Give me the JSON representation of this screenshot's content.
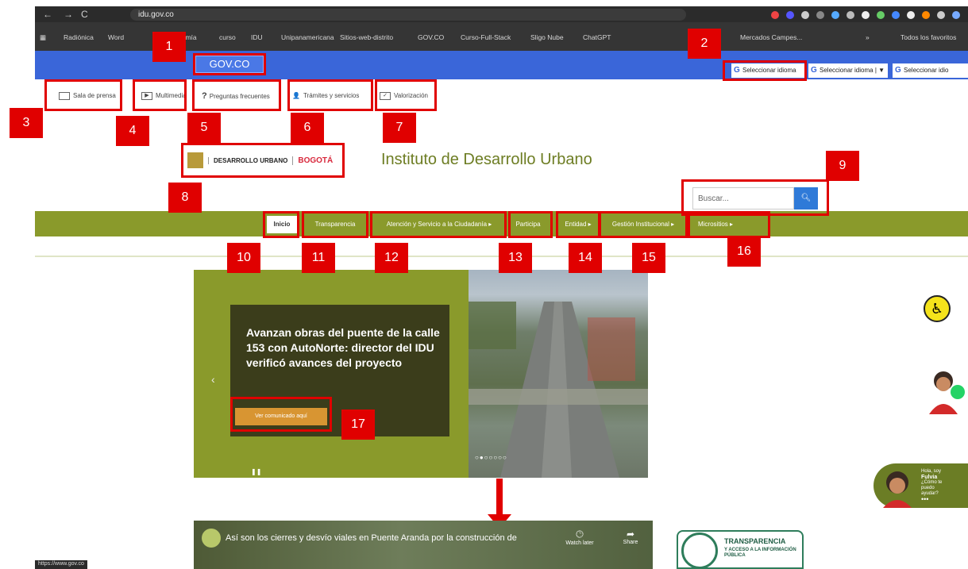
{
  "browser": {
    "url": "idu.gov.co",
    "bookmarks": [
      "Radiónica",
      "Word",
      "nomía",
      "curso",
      "IDU",
      "Unipanamericana",
      "Sitios-web-distrito",
      "GOV.CO",
      "Curso-Full-Stack",
      "Sligo Nube",
      "ChatGPT",
      "Mercados Campes...",
      "»",
      "Todos los favoritos"
    ],
    "status_url": "https://www.gov.co"
  },
  "gov_bar": {
    "logo": "GOV.CO",
    "language_selectors": [
      "Seleccionar idioma",
      "Seleccionar idioma | ▼",
      "Seleccionar idio"
    ]
  },
  "toolbar": {
    "items": [
      "Sala de prensa",
      "Multimedia",
      "Preguntas frecuentes",
      "Trámites y servicios",
      "Valorización"
    ]
  },
  "header": {
    "logo_text_1": "DESARROLLO URBANO",
    "logo_text_2": "BOGOTÁ",
    "title": "Instituto de Desarrollo Urbano"
  },
  "search": {
    "placeholder": "Buscar...",
    "button_icon": "search-icon"
  },
  "nav": {
    "items": [
      "Inicio",
      "Transparencia",
      "Atención y Servicio a la Ciudadanía ▸",
      "Participa",
      "Entidad ▸",
      "Gestión Institucional ▸",
      "Micrositios ▸"
    ]
  },
  "hero": {
    "title": "Avanzan obras del puente de la calle 153 con AutoNorte: director del IDU verificó avances del proyecto",
    "button": "Ver comunicado aquí",
    "prev": "‹",
    "dots": "○●○○○○○",
    "pause": "❚❚"
  },
  "video": {
    "title": "Así son los cierres y desvío viales en Puente Aranda por la construcción de",
    "watch_later": "Watch later",
    "share": "Share"
  },
  "transparency": {
    "title": "TRANSPARENCIA",
    "subtitle": "Y ACCESO A LA INFORMACIÓN PÚBLICA"
  },
  "chatbot": {
    "greeting": "Hola, soy",
    "name": "Fulvia",
    "prompt": "¿Cómo te puedo ayudar?",
    "more": "•••"
  },
  "annotations": [
    "1",
    "2",
    "3",
    "4",
    "5",
    "6",
    "7",
    "8",
    "9",
    "10",
    "11",
    "12",
    "13",
    "14",
    "15",
    "16",
    "17"
  ],
  "colors": {
    "annotation_red": "#e00000",
    "gov_blue": "#3a66d9",
    "idu_green": "#8a9a2b",
    "button_orange": "#d89532"
  }
}
